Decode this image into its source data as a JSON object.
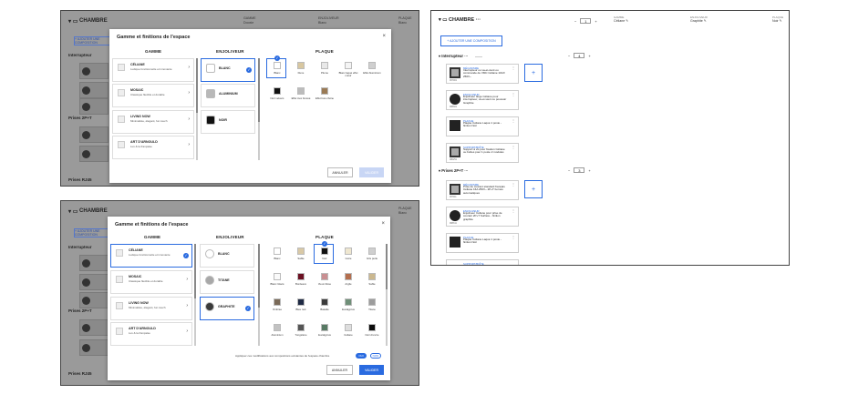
{
  "room": {
    "title": "CHAMBRE",
    "add_button": "+ AJOUTER UNE COMPOSITION"
  },
  "meta": {
    "gamme_label": "GAMME",
    "gamme_value": "Céliane",
    "enjoliveur_label": "ENJOLIVEUR",
    "enjoliveur_value": "Graphite",
    "plaque_label": "PLAQUE",
    "plaque_value": "Noir",
    "bg_gamme_value": "Dooxie",
    "bg_enjoliveur_value": "Blanc",
    "bg_plaque_value": "Blanc"
  },
  "stepper": {
    "room_qty": "1",
    "interrupteur_qty": "4",
    "prises_qty": "3"
  },
  "sections": {
    "interrupteur": "Interrupteur",
    "prises": "Prises 2P+T",
    "rj45": "Prises RJ45"
  },
  "modal": {
    "title": "Gamme et finitions de l'espace",
    "close": "×",
    "col_gamme": "GAMME",
    "col_enjoliveur": "ENJOLIVEUR",
    "col_plaque": "PLAQUE",
    "gammes": [
      {
        "name": "CÉLIANE",
        "desc": "Ludique fonctionnelle et innovante"
      },
      {
        "name": "MOSAIC",
        "desc": "Classique flexible et durable"
      },
      {
        "name": "LIVING NOW",
        "desc": "Minimaliste, élégant, fun touch"
      },
      {
        "name": "ART D'ARNOULD",
        "desc": "Lux & la française"
      }
    ],
    "enjoliveurs_1": [
      {
        "name": "BLANC",
        "color": "#ffffff"
      },
      {
        "name": "ALUMINIUM",
        "color": "#b8b8b8"
      },
      {
        "name": "NOIR",
        "color": "#111111"
      }
    ],
    "enjoliveurs_2": [
      {
        "name": "BLANC",
        "color": "#ffffff"
      },
      {
        "name": "TITANE",
        "color": "#a8a8a8"
      },
      {
        "name": "GRAPHITE",
        "color": "#3a3a3a"
      }
    ],
    "plaques_1": [
      {
        "name": "Blanc",
        "color": "#ffffff"
      },
      {
        "name": "Dune",
        "color": "#d8c7a0"
      },
      {
        "name": "Plume",
        "color": "#e8e8e8"
      },
      {
        "name": "Blanc laqué effet miroir",
        "color": "#f4f4f4"
      },
      {
        "name": "Effet Aluminium",
        "color": "#cfcfcf"
      },
      {
        "name": "Noir velours",
        "color": "#111111"
      },
      {
        "name": "Effet inox brossé",
        "color": "#bcbcbc"
      },
      {
        "name": "Effet bois chêne",
        "color": "#9a7a55"
      }
    ],
    "plaques_2": [
      {
        "name": "Blanc",
        "color": "#ffffff"
      },
      {
        "name": "Sable",
        "color": "#d9c9a6"
      },
      {
        "name": "Noir",
        "color": "#111111"
      },
      {
        "name": "Ivoire",
        "color": "#efe7d0"
      },
      {
        "name": "Gris perle",
        "color": "#cfcfcf"
      },
      {
        "name": "Blanc Glacé",
        "color": "#fafafa"
      },
      {
        "name": "Bordeaux",
        "color": "#6b1022"
      },
      {
        "name": "Vieux Rose",
        "color": "#c98f92"
      },
      {
        "name": "Argile",
        "color": "#b46e4e"
      },
      {
        "name": "Sable",
        "color": "#cbb88f"
      },
      {
        "name": "Ombrée",
        "color": "#7a6a58"
      },
      {
        "name": "Bleu nuit",
        "color": "#1f2a44"
      },
      {
        "name": "Basalte",
        "color": "#3b3b3b"
      },
      {
        "name": "Eucalyptus",
        "color": "#6f8f78"
      },
      {
        "name": "Titane",
        "color": "#9c9c9c"
      },
      {
        "name": "Aluminium",
        "color": "#c2c2c2"
      },
      {
        "name": "Tungstène",
        "color": "#555555"
      },
      {
        "name": "Eucalyptus",
        "color": "#587a64"
      },
      {
        "name": "Céliane",
        "color": "#dedede"
      },
      {
        "name": "Noir d'encre",
        "color": "#0c0c0c"
      }
    ],
    "cancel": "ANNULER",
    "validate": "VALIDER",
    "apply_text": "Appliquer ces modifications aux compositions existantes de l'espace chambre",
    "oui": "OUI",
    "non": "NON"
  },
  "compositions": {
    "interrupteur": [
      {
        "label": "MÉCANISME",
        "text": "Interrupteur ou va-et-vient ou commande de VMC Céliane 10AX 250V~",
        "ref": "067001",
        "thumb": "round-light"
      },
      {
        "label": "ENJOLIVEUR",
        "text": "Enjoliveur large Céliane pour interrupteur, va-et-vient ou poussoir Graphite",
        "ref": "068301",
        "thumb": "round"
      },
      {
        "label": "PLAQUE",
        "text": "Plaque Céliane Laqué 1 poste - finition Noir",
        "ref": "",
        "thumb": "square"
      },
      {
        "label": "SUPPORT/BOÎTE",
        "text": "Support à vis pour fixation Céliane ou boîtes pour 1 poste 2 modules",
        "ref": "080251",
        "thumb": "light"
      }
    ],
    "prises": [
      {
        "label": "MÉCANISME",
        "text": "Prise de courant standard français Céliane 16A 250V~ 2P+T bornes automatiques",
        "ref": "067111",
        "thumb": "round-light"
      },
      {
        "label": "ENJOLIVEUR",
        "text": "Enjoliveur Céliane pour prise de courant 2P+T Surface - finition graphite",
        "ref": "068311",
        "thumb": "round"
      },
      {
        "label": "PLAQUE",
        "text": "Plaque Céliane Laqué 1 poste - finition Noir",
        "ref": "",
        "thumb": "square"
      },
      {
        "label": "SUPPORT/BOÎTE",
        "text": "",
        "ref": "",
        "thumb": "light"
      }
    ]
  }
}
